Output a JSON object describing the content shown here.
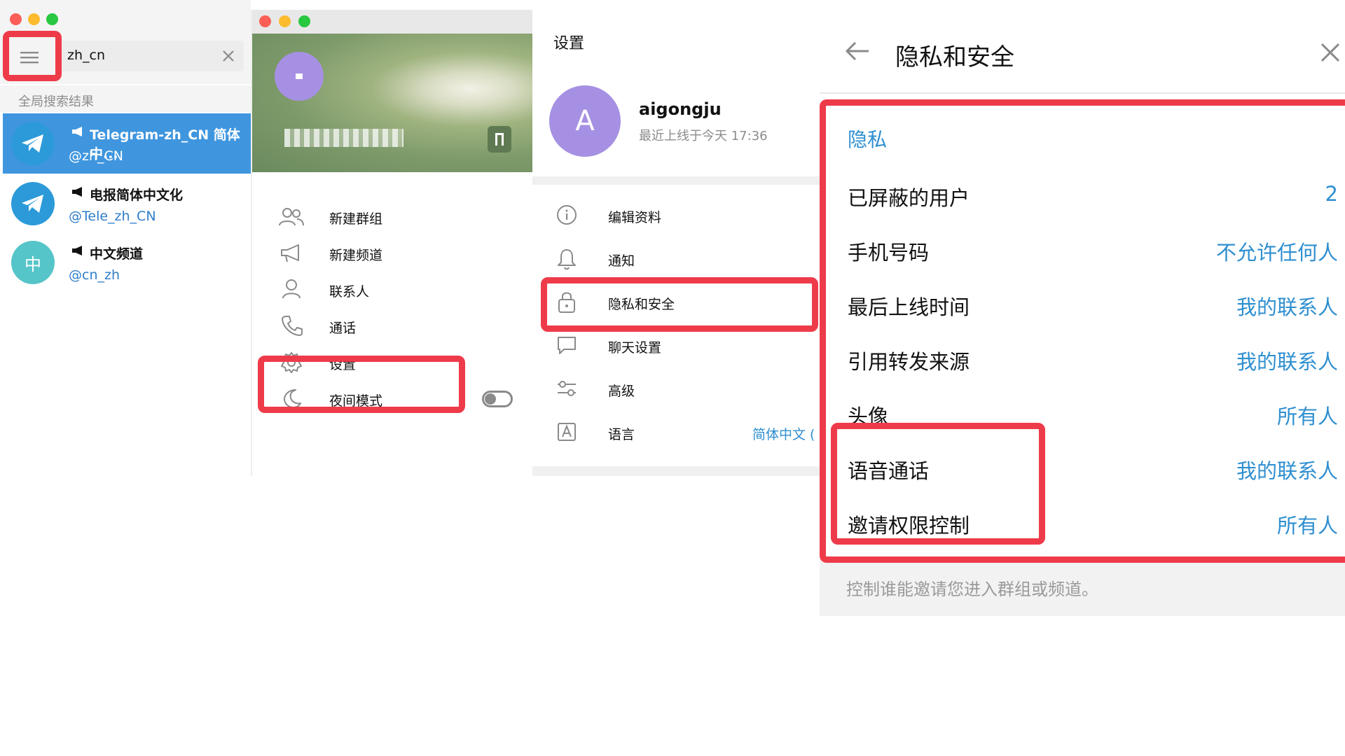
{
  "search_panel": {
    "query": "zh_cn",
    "section_title": "全局搜索结果",
    "results": [
      {
        "title": "Telegram-zh_CN 简体中...",
        "handle": "@zh_CN",
        "avatar_letter": ""
      },
      {
        "title": "电报简体中文化",
        "handle": "@Tele_zh_CN",
        "avatar_letter": ""
      },
      {
        "title": "中文频道",
        "handle": "@cn_zh",
        "avatar_letter": "中"
      }
    ]
  },
  "menu_panel": {
    "items": [
      {
        "label": "新建群组",
        "icon": "group-icon"
      },
      {
        "label": "新建频道",
        "icon": "megaphone-icon"
      },
      {
        "label": "联系人",
        "icon": "person-icon"
      },
      {
        "label": "通话",
        "icon": "phone-icon"
      },
      {
        "label": "设置",
        "icon": "gear-icon"
      },
      {
        "label": "夜间模式",
        "icon": "moon-icon"
      }
    ]
  },
  "settings_panel": {
    "title": "设置",
    "profile": {
      "avatar_letter": "A",
      "name": "aigongju",
      "status": "最近上线于今天 17:36"
    },
    "items": [
      {
        "label": "编辑资料",
        "icon": "info-icon",
        "value": ""
      },
      {
        "label": "通知",
        "icon": "bell-icon",
        "value": ""
      },
      {
        "label": "隐私和安全",
        "icon": "lock-icon",
        "value": ""
      },
      {
        "label": "聊天设置",
        "icon": "chat-icon",
        "value": ""
      },
      {
        "label": "高级",
        "icon": "sliders-icon",
        "value": ""
      },
      {
        "label": "语言",
        "icon": "language-icon",
        "value": "简体中文 ("
      }
    ]
  },
  "privacy_panel": {
    "title": "隐私和安全",
    "section_header": "隐私",
    "rows": [
      {
        "label": "已屏蔽的用户",
        "value": "2"
      },
      {
        "label": "手机号码",
        "value": "不允许任何人"
      },
      {
        "label": "最后上线时间",
        "value": "我的联系人"
      },
      {
        "label": "引用转发来源",
        "value": "我的联系人"
      },
      {
        "label": "头像",
        "value": "所有人"
      },
      {
        "label": "语音通话",
        "value": "我的联系人"
      },
      {
        "label": "邀请权限控制",
        "value": "所有人"
      }
    ],
    "footer_note": "控制谁能邀请您进入群组或频道。"
  },
  "colors": {
    "accent": "#2f8fd0",
    "highlight": "#ee3b4a",
    "selected_row": "#3f96de",
    "avatar_purple": "#a690e3"
  }
}
